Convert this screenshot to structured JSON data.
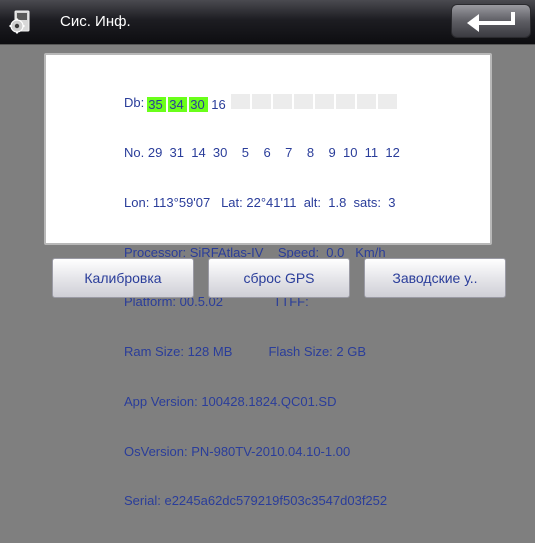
{
  "title_bar": {
    "title": "Сис. Инф.",
    "left_icon": "gear-icon",
    "back_icon": "return-arrow-icon"
  },
  "info": {
    "db_label": "Db:",
    "db_signals": [
      "35",
      "34",
      "30",
      "16",
      "",
      "",
      "",
      "",
      "",
      "",
      "",
      ""
    ],
    "db_highlighted_count": 3,
    "sat_numbers_line": "No. 29  31  14  30    5    6    7    8    9  10  11  12",
    "lon_lat_line": "Lon: 113°59'07   Lat: 22°41'11  alt:  1.8  sats:  3",
    "processor_line": "Processor: SiRFAtlas-IV    Speed:  0.0   Km/h",
    "platform_line": "Platform: 00.5.02              TTFF:",
    "ram_flash_line": "Ram Size: 128 MB          Flash Size: 2 GB",
    "app_version_line": "App Version: 100428.1824.QC01.SD",
    "os_version_line": "OsVersion: PN-980TV-2010.04.10-1.00",
    "serial_line": "Serial: e2245a62dc579219f503c3547d03f252"
  },
  "buttons": {
    "calibrate": "Калибровка",
    "reset_gps": "сброс GPS",
    "factory": "Заводские у.."
  },
  "colors": {
    "text": "#2a3d9a",
    "signal_highlight": "#6aff1a",
    "background": "#7f7f7f",
    "titlebar": "#1d1d22"
  }
}
